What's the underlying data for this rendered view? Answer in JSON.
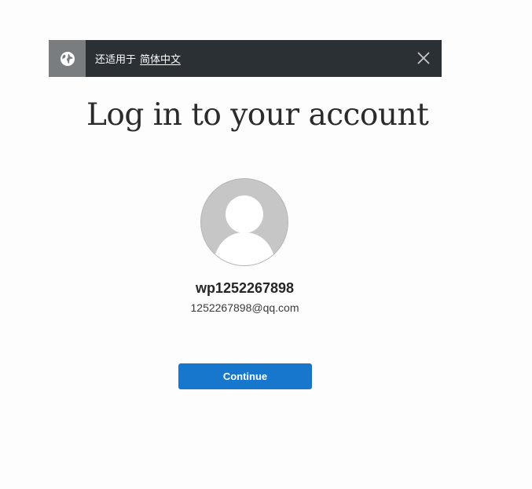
{
  "language_banner": {
    "text": "还适用于",
    "language_link": "简体中文",
    "globe_icon": "globe-icon",
    "close_icon": "close-icon"
  },
  "login": {
    "title": "Log in to your account",
    "avatar_icon": "user-silhouette-icon",
    "username": "wp1252267898",
    "email": "1252267898@qq.com",
    "continue_label": "Continue"
  },
  "colors": {
    "banner_bg": "#2b3035",
    "globe_box_bg": "#7a7d80",
    "button_bg": "#1777cc",
    "avatar_bg": "#c6c6c6"
  }
}
